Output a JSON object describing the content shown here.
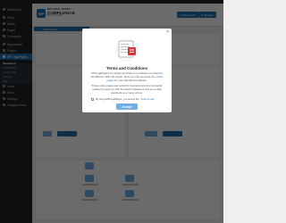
{
  "sidebar": {
    "items": [
      {
        "label": "Dashboard",
        "icon": "dashboard-icon"
      },
      {
        "label": "Posts",
        "icon": "pin-icon"
      },
      {
        "label": "Media",
        "icon": "media-icon"
      },
      {
        "label": "Pages",
        "icon": "page-icon"
      },
      {
        "label": "Comments",
        "icon": "comment-icon"
      },
      {
        "label": "Appearance",
        "icon": "brush-icon"
      },
      {
        "label": "Plugins",
        "icon": "plugin-icon"
      },
      {
        "label": "WP LegalPages",
        "icon": "legal-icon"
      }
    ],
    "submenu": [
      "Dashboard",
      "Legal Pages",
      "Create Page",
      "Settings",
      "Help"
    ],
    "items_bottom": [
      {
        "label": "Users",
        "icon": "users-icon"
      },
      {
        "label": "Tools",
        "icon": "tools-icon"
      },
      {
        "label": "Settings",
        "icon": "settings-icon"
      },
      {
        "label": "Collapse menu",
        "icon": "collapse-icon"
      }
    ]
  },
  "header": {
    "logo_mark": "WP",
    "logo_line1": "WP LEGAL PAGES",
    "logo_line2": "COMPLIANCE",
    "logo_line3": "PLATFORM",
    "help_label": "Help Guide",
    "support_label": "Support"
  },
  "tabs": {
    "dashboard": "Dashboard"
  },
  "modal": {
    "close": "×",
    "title": "Terms and Conditions",
    "body_1": "WPLegalPages is a plugin and there is a software provided for WordPress. With this plugin, there you can generate",
    "body_link": "25+ policy pages",
    "body_2": "for your WordPress website.",
    "body_3": "These policy pages are suited for business and are constantly updated to keep up with the latest regulations and up-to-date standards and many others.",
    "agree_prefix": "By using WPLegalPages, you accept the",
    "agree_link": "terms of use",
    "accept_label": "Accept"
  },
  "colors": {
    "accent": "#2271b1",
    "accent_light": "#72aee6",
    "sidebar_bg": "#1d2327"
  }
}
